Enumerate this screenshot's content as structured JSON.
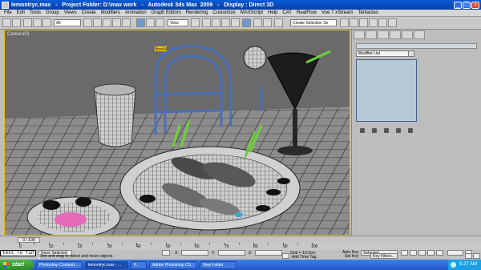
{
  "title": {
    "name": "lemontryc.max",
    "folder": "Project Folder: D:\\max work",
    "app": "Autodesk 3ds Max  2009",
    "display": "Display : Direct 3D"
  },
  "menu": [
    "File",
    "Edit",
    "Tools",
    "Group",
    "Views",
    "Create",
    "Modifiers",
    "Animation",
    "Graph Editors",
    "Rendering",
    "Customize",
    "MAXScript",
    "Help",
    "CAT",
    "RealFlow",
    "Vue 7 xStream",
    "Tentacles"
  ],
  "toolbar": {
    "filter": "All",
    "view": "View",
    "named_selection": "Create Selection Se"
  },
  "viewport": {
    "label": "Camera01",
    "selected_label": "Box04",
    "colors": {
      "floor": "#8a8a8a",
      "grid": "#1a1a1a",
      "selection": "#ffcc00"
    }
  },
  "command_panel": {
    "modifier_list": "Modifier List",
    "colors": {
      "stack_bg": "#b6c9d4",
      "accent": "#44608a"
    }
  },
  "timeline": {
    "slider": "0 / 100"
  },
  "ruler": {
    "labels": [
      "0",
      "10",
      "20",
      "30",
      "40",
      "50",
      "60",
      "70",
      "80",
      "90",
      "100"
    ]
  },
  "status": {
    "selection": "None Selected",
    "prompt": "Click and drag to select and move objects",
    "x_label": "X:",
    "y_label": "Y:",
    "z_label": "Z:",
    "grid": "Grid = 10.0cm",
    "add_time_tag": "Add Time Tag",
    "auto_key": "Auto Key",
    "set_key": "Set Key",
    "selected": "Selected",
    "key_filters": "Key Filters...",
    "textfin": "text To fin"
  },
  "taskbar": {
    "start": "start",
    "buttons": [
      "Photoshop Contests ...",
      "lemontryc.max - ...",
      "P...",
      "Adobe Photoshop CS...",
      "New Folder"
    ],
    "clock": "5:27 AM",
    "colors": {
      "bar": "#2459c8",
      "start": "#2e8a2a"
    }
  }
}
